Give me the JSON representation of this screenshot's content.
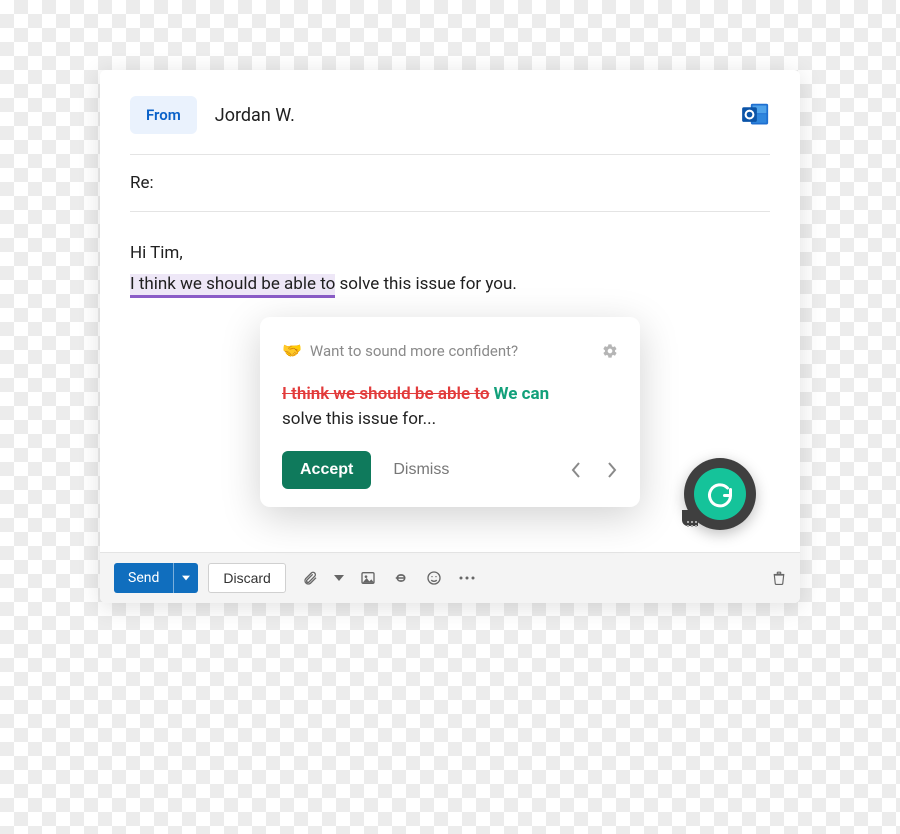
{
  "header": {
    "from_label": "From",
    "from_name": "Jordan W."
  },
  "subject": {
    "prefix": "Re:"
  },
  "body": {
    "greeting": "Hi Tim,",
    "highlighted": "I think we should be able to",
    "rest": " solve this issue for you."
  },
  "suggestion": {
    "emoji": "🤝",
    "prompt": "Want to sound more confident?",
    "removed": "I think we should be able to",
    "added": "We can",
    "tail": "solve this issue for...",
    "accept_label": "Accept",
    "dismiss_label": "Dismiss"
  },
  "toolbar": {
    "send_label": "Send",
    "discard_label": "Discard"
  }
}
